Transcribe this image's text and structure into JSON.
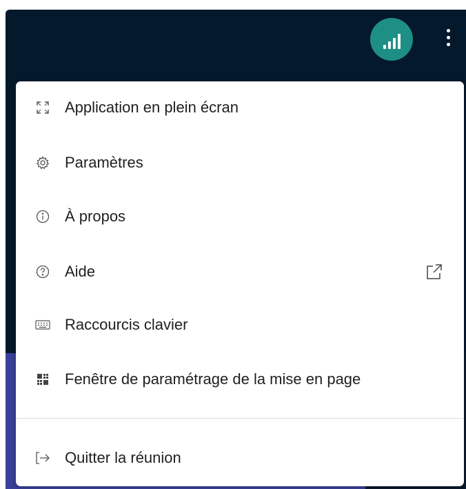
{
  "topbar": {
    "signal_button_color": "#1d8f84",
    "signal_icon": "signal-bars-icon",
    "more_icon": "more-vertical-icon"
  },
  "menu": {
    "items": [
      {
        "label": "Application en plein écran",
        "icon": "fullscreen-icon"
      },
      {
        "label": "Paramètres",
        "icon": "gear-icon"
      },
      {
        "label": "À propos",
        "icon": "info-icon"
      },
      {
        "label": "Aide",
        "icon": "help-icon",
        "trailing_icon": "external-link-icon"
      },
      {
        "label": "Raccourcis clavier",
        "icon": "keyboard-icon"
      },
      {
        "label": "Fenêtre de paramétrage de la mise en page",
        "icon": "layout-grid-icon"
      }
    ],
    "footer_items": [
      {
        "label": "Quitter la réunion",
        "icon": "sign-out-icon"
      }
    ]
  },
  "colors": {
    "topbar_background": "#05192c",
    "accent_teal": "#1d8f84",
    "video_tile_blue": "#3b4199"
  }
}
